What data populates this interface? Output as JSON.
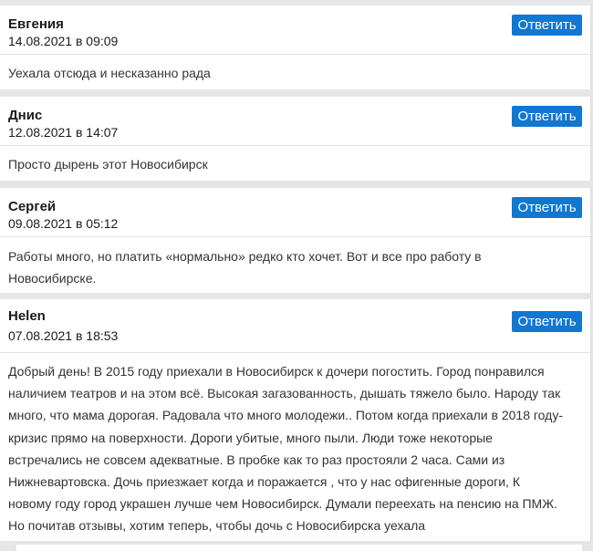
{
  "comments": [
    {
      "author": "Евгения",
      "date": "14.08.2021 в 09:09",
      "reply_label": "Ответить",
      "text": "Уехала отсюда и несказанно рада"
    },
    {
      "author": "Днис",
      "date": "12.08.2021 в 14:07",
      "reply_label": "Ответить",
      "text": "Просто дырень этот Новосибирск"
    },
    {
      "author": "Сергей",
      "date": "09.08.2021 в 05:12",
      "reply_label": "Ответить",
      "text": "Работы много, но платить «нормально» редко кто хочет. Вот и все про работу в\nНовосибирске."
    },
    {
      "author": "Helen",
      "date": "07.08.2021 в 18:53",
      "reply_label": "Ответить",
      "text": "Добрый день! В 2015 году приехали в Новосибирск к дочери погостить. Город понравился\nналичием театров и на этом всё. Высокая загазованность, дышать тяжело было. Народу так\nмного, что мама дорогая. Радовала что много молодежи.. Потом когда приехали в 2018 году-\nкризис прямо на поверхности. Дороги убитые, много пыли. Люди тоже некоторые\nвстречались не совсем адекватные. В пробке как то раз простояли 2 часа. Сами из\nНижневартовска. Дочь приезжает когда и поражается , что у нас офигенные дороги, К\nновому году город украшен лучше чем Новосибирск. Думали переехать на пенсию на ПМЖ.\nНо почитав отзывы, хотим теперь, чтобы дочь с Новосибирска уехала"
    }
  ],
  "colors": {
    "reply_button": "#1177d1",
    "background": "#e6e6e6",
    "card": "#ffffff"
  }
}
